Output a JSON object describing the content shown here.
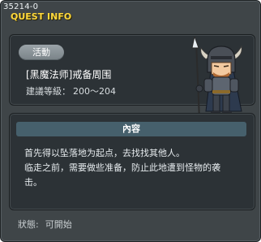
{
  "window": {
    "quest_id": "35214-0",
    "title": "QUEST INFO"
  },
  "header": {
    "tag": "活動",
    "quest_name": "[黑魔法师]戒备周围",
    "level_label": "建議等級：",
    "level_range": "200～204"
  },
  "content": {
    "header": "內容",
    "lines": [
      "首先得以坠落地为起点，去找找其他人。",
      "临走之前，需要做些准备，防止此地遭到怪物的袭",
      "击。"
    ]
  },
  "status": {
    "label": "狀態:",
    "value": "可開始"
  },
  "icons": {
    "npc": "armored-knight-npc-icon"
  },
  "colors": {
    "title": "#ffd93c",
    "window_bg": "#3f4548",
    "panel_bg": "#2c3236",
    "content_header_bg": "#46606c",
    "tag_bg": "#8a9398"
  }
}
